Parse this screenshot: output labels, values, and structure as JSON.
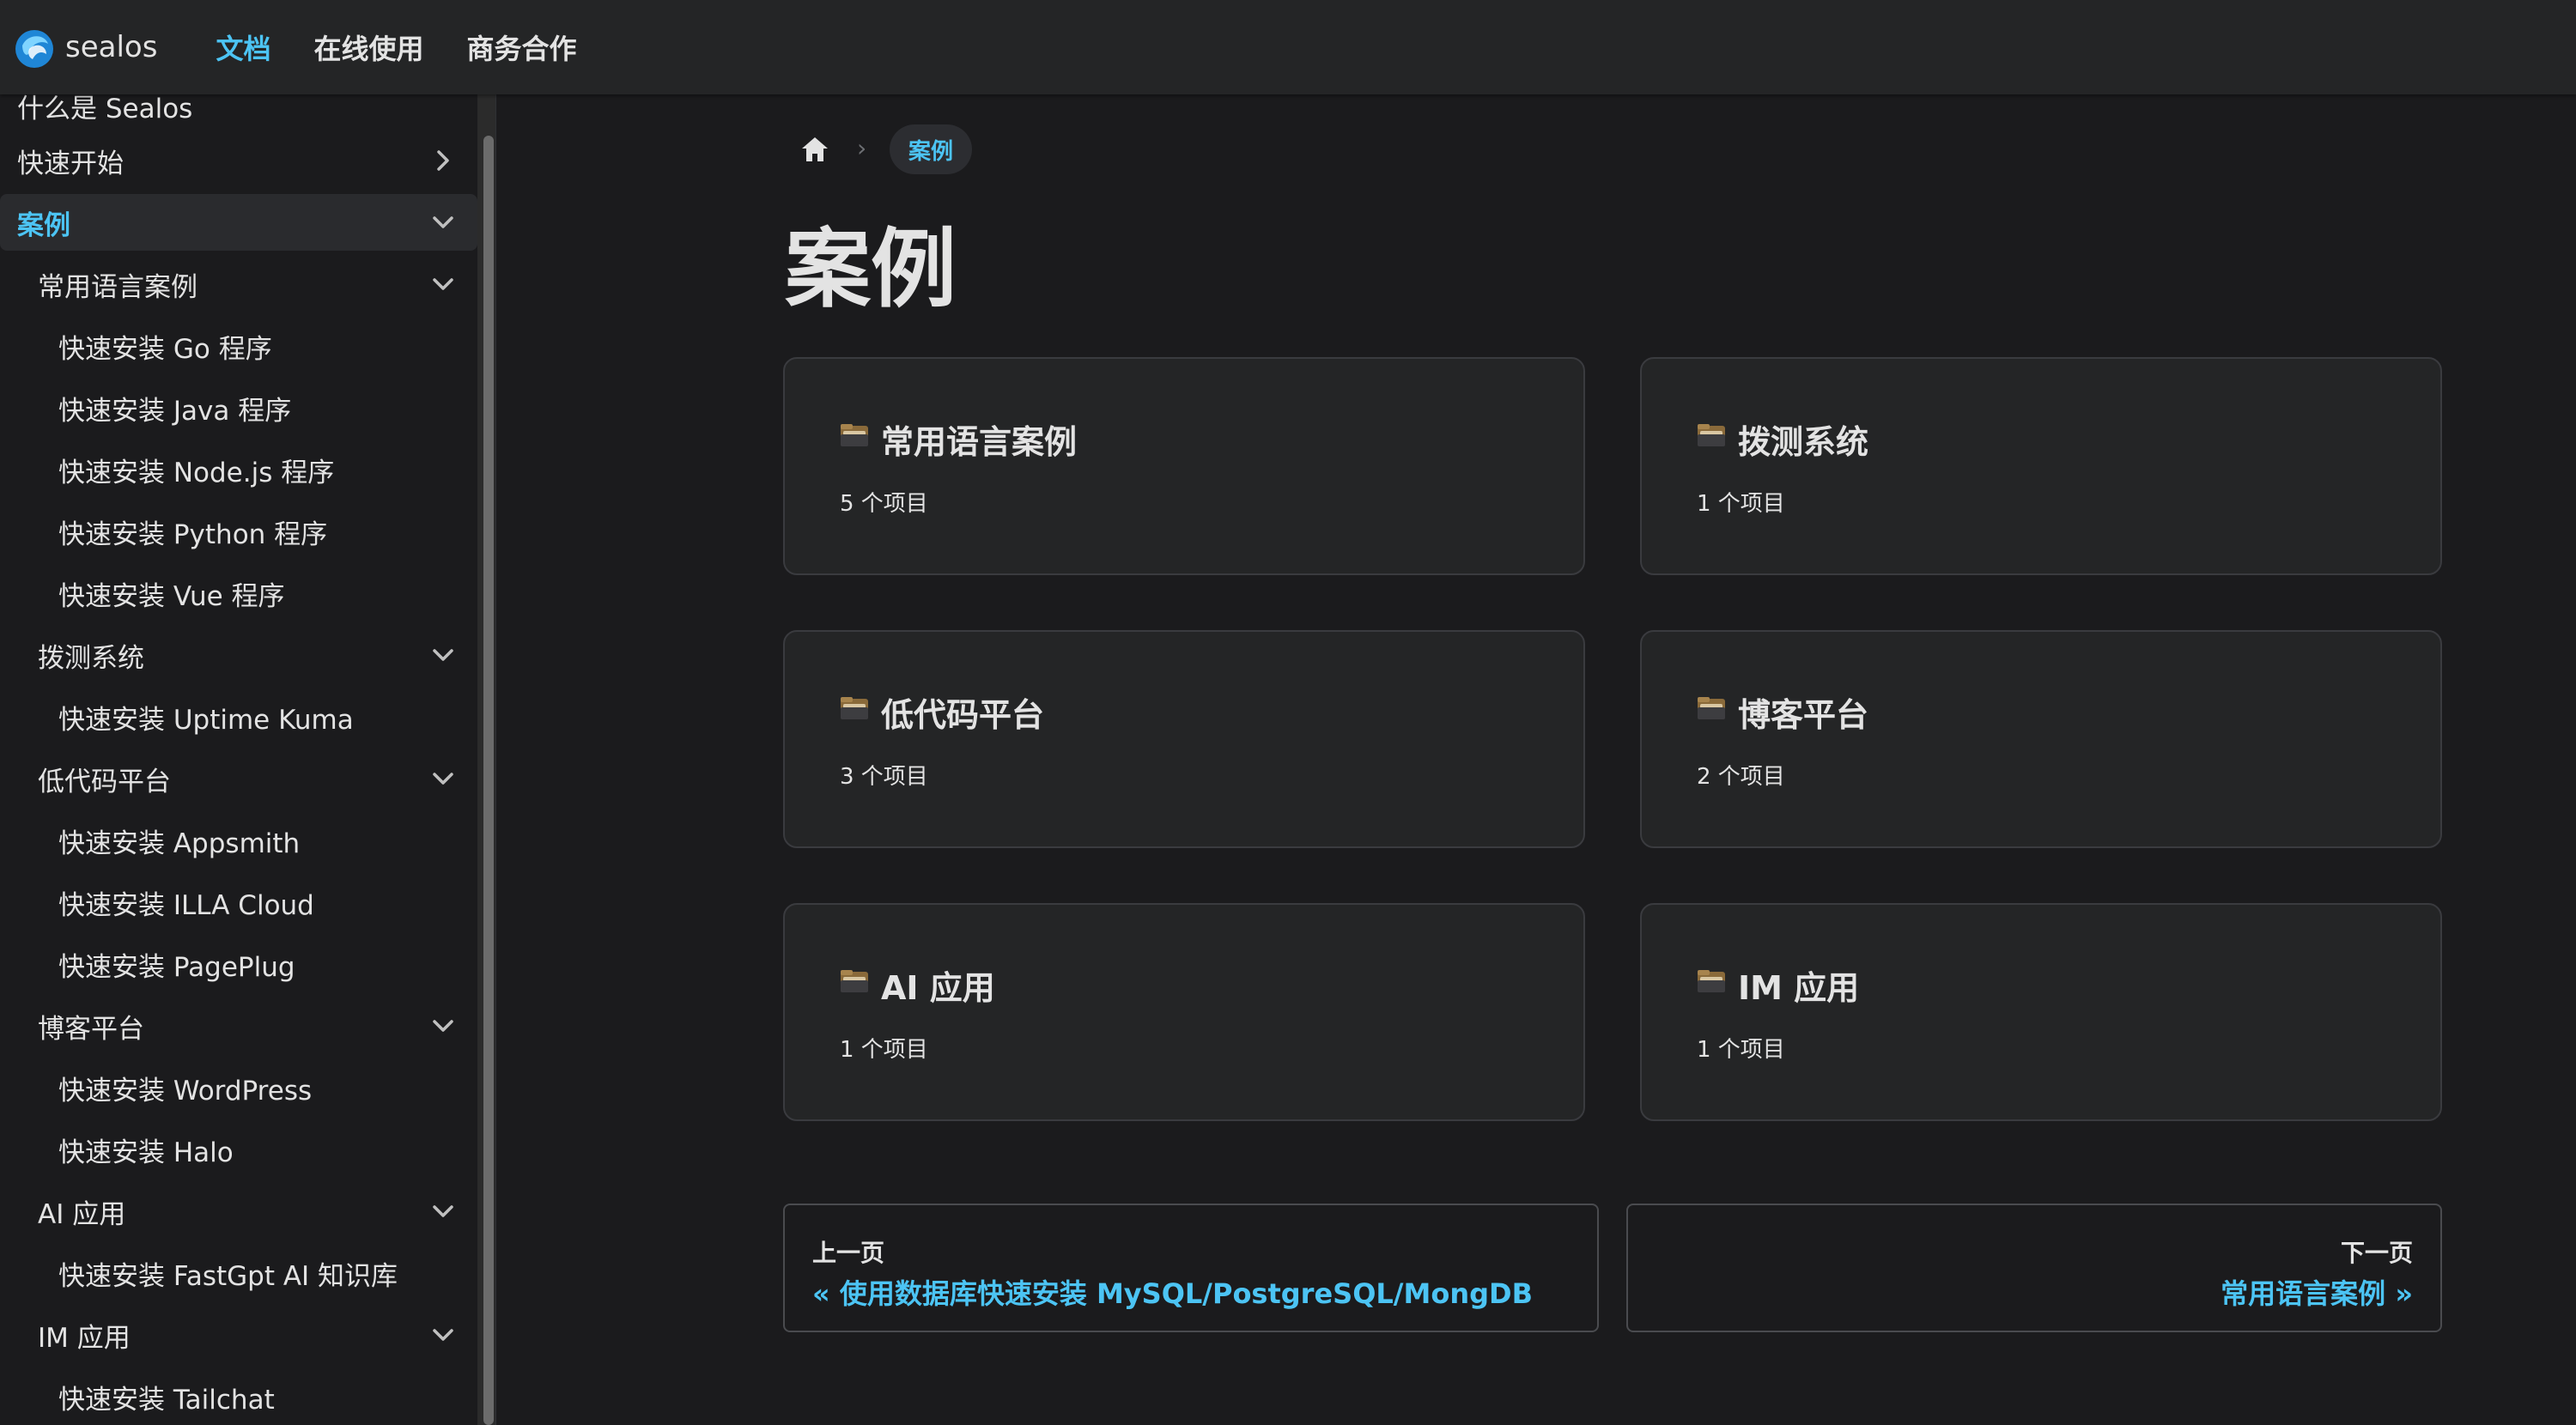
{
  "brand": {
    "logo_text": "sealos"
  },
  "nav": {
    "docs": "文档",
    "online": "在线使用",
    "business": "商务合作"
  },
  "sidebar": {
    "items": [
      {
        "label": "什么是 Sealos"
      },
      {
        "label": "快速开始"
      },
      {
        "label": "案例"
      },
      {
        "label": "常用语言案例"
      },
      {
        "label": "快速安装 Go 程序"
      },
      {
        "label": "快速安装 Java 程序"
      },
      {
        "label": "快速安装 Node.js 程序"
      },
      {
        "label": "快速安装 Python 程序"
      },
      {
        "label": "快速安装 Vue 程序"
      },
      {
        "label": "拨测系统"
      },
      {
        "label": "快速安装 Uptime Kuma"
      },
      {
        "label": "低代码平台"
      },
      {
        "label": "快速安装 Appsmith"
      },
      {
        "label": "快速安装 ILLA Cloud"
      },
      {
        "label": "快速安装 PagePlug"
      },
      {
        "label": "博客平台"
      },
      {
        "label": "快速安装 WordPress"
      },
      {
        "label": "快速安装 Halo"
      },
      {
        "label": "AI 应用"
      },
      {
        "label": "快速安装 FastGpt AI 知识库"
      },
      {
        "label": "IM 应用"
      },
      {
        "label": "快速安装 Tailchat"
      }
    ]
  },
  "breadcrumb": {
    "current": "案例"
  },
  "page": {
    "title": "案例"
  },
  "cards": [
    {
      "title": "常用语言案例",
      "count": "5 个项目"
    },
    {
      "title": "拨测系统",
      "count": "1 个项目"
    },
    {
      "title": "低代码平台",
      "count": "3 个项目"
    },
    {
      "title": "博客平台",
      "count": "2 个项目"
    },
    {
      "title": "AI 应用",
      "count": "1 个项目"
    },
    {
      "title": "IM 应用",
      "count": "1 个项目"
    }
  ],
  "pagination": {
    "prev_sub": "上一页",
    "prev_label": "« 使用数据库快速安装 MySQL/PostgreSQL/MongDB",
    "next_sub": "下一页",
    "next_label": "常用语言案例 »"
  },
  "colors": {
    "accent": "#4cc4f4",
    "background": "#1b1b1d",
    "navbar": "#242526"
  }
}
